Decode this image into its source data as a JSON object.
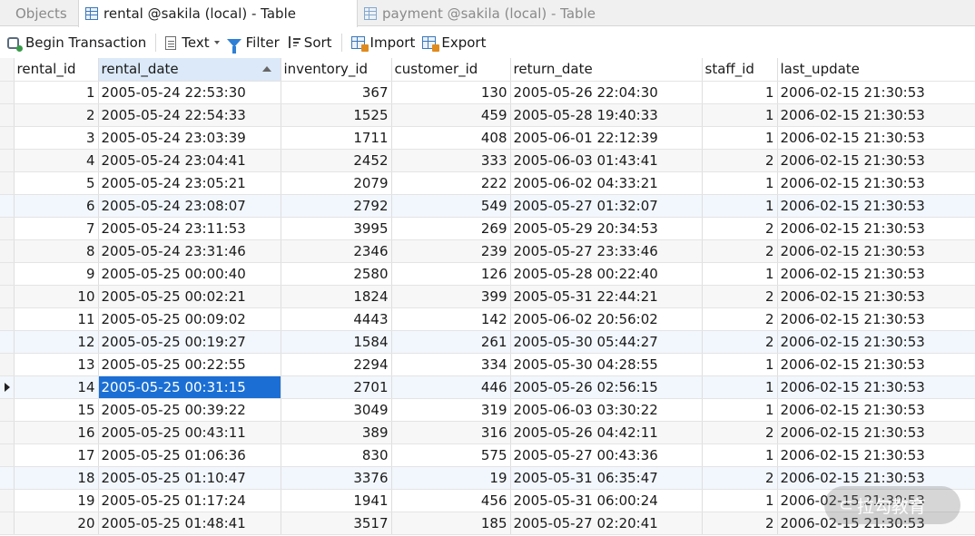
{
  "tabs": [
    {
      "label": "Objects",
      "active": false
    },
    {
      "label": "rental @sakila (local) - Table",
      "active": true
    },
    {
      "label": "payment @sakila (local) - Table",
      "active": false
    }
  ],
  "toolbar": {
    "begin_transaction": "Begin Transaction",
    "text": "Text",
    "filter": "Filter",
    "sort": "Sort",
    "import": "Import",
    "export": "Export"
  },
  "grid": {
    "columns": [
      "rental_id",
      "rental_date",
      "inventory_id",
      "customer_id",
      "return_date",
      "staff_id",
      "last_update"
    ],
    "sorted_column": "rental_date",
    "rows": [
      [
        "1",
        "2005-05-24 22:53:30",
        "367",
        "130",
        "2005-05-26 22:04:30",
        "1",
        "2006-02-15 21:30:53"
      ],
      [
        "2",
        "2005-05-24 22:54:33",
        "1525",
        "459",
        "2005-05-28 19:40:33",
        "1",
        "2006-02-15 21:30:53"
      ],
      [
        "3",
        "2005-05-24 23:03:39",
        "1711",
        "408",
        "2005-06-01 22:12:39",
        "1",
        "2006-02-15 21:30:53"
      ],
      [
        "4",
        "2005-05-24 23:04:41",
        "2452",
        "333",
        "2005-06-03 01:43:41",
        "2",
        "2006-02-15 21:30:53"
      ],
      [
        "5",
        "2005-05-24 23:05:21",
        "2079",
        "222",
        "2005-06-02 04:33:21",
        "1",
        "2006-02-15 21:30:53"
      ],
      [
        "6",
        "2005-05-24 23:08:07",
        "2792",
        "549",
        "2005-05-27 01:32:07",
        "1",
        "2006-02-15 21:30:53"
      ],
      [
        "7",
        "2005-05-24 23:11:53",
        "3995",
        "269",
        "2005-05-29 20:34:53",
        "2",
        "2006-02-15 21:30:53"
      ],
      [
        "8",
        "2005-05-24 23:31:46",
        "2346",
        "239",
        "2005-05-27 23:33:46",
        "2",
        "2006-02-15 21:30:53"
      ],
      [
        "9",
        "2005-05-25 00:00:40",
        "2580",
        "126",
        "2005-05-28 00:22:40",
        "1",
        "2006-02-15 21:30:53"
      ],
      [
        "10",
        "2005-05-25 00:02:21",
        "1824",
        "399",
        "2005-05-31 22:44:21",
        "2",
        "2006-02-15 21:30:53"
      ],
      [
        "11",
        "2005-05-25 00:09:02",
        "4443",
        "142",
        "2005-06-02 20:56:02",
        "2",
        "2006-02-15 21:30:53"
      ],
      [
        "12",
        "2005-05-25 00:19:27",
        "1584",
        "261",
        "2005-05-30 05:44:27",
        "2",
        "2006-02-15 21:30:53"
      ],
      [
        "13",
        "2005-05-25 00:22:55",
        "2294",
        "334",
        "2005-05-30 04:28:55",
        "1",
        "2006-02-15 21:30:53"
      ],
      [
        "14",
        "2005-05-25 00:31:15",
        "2701",
        "446",
        "2005-05-26 02:56:15",
        "1",
        "2006-02-15 21:30:53"
      ],
      [
        "15",
        "2005-05-25 00:39:22",
        "3049",
        "319",
        "2005-06-03 03:30:22",
        "1",
        "2006-02-15 21:30:53"
      ],
      [
        "16",
        "2005-05-25 00:43:11",
        "389",
        "316",
        "2005-05-26 04:42:11",
        "2",
        "2006-02-15 21:30:53"
      ],
      [
        "17",
        "2005-05-25 01:06:36",
        "830",
        "575",
        "2005-05-27 00:43:36",
        "1",
        "2006-02-15 21:30:53"
      ],
      [
        "18",
        "2005-05-25 01:10:47",
        "3376",
        "19",
        "2005-05-31 06:35:47",
        "2",
        "2006-02-15 21:30:53"
      ],
      [
        "19",
        "2005-05-25 01:17:24",
        "1941",
        "456",
        "2005-05-31 06:00:24",
        "1",
        "2006-02-15 21:30:53"
      ],
      [
        "20",
        "2005-05-25 01:48:41",
        "3517",
        "185",
        "2005-05-27 02:20:41",
        "2",
        "2006-02-15 21:30:53"
      ]
    ],
    "current_row": 14,
    "selected_cell": {
      "row": 14,
      "column": "rental_date"
    }
  },
  "watermark": "拉勾教育",
  "colors": {
    "selection": "#1b6fd4",
    "sorted_header": "#dbe9f8",
    "accent": "#3d78b8"
  }
}
